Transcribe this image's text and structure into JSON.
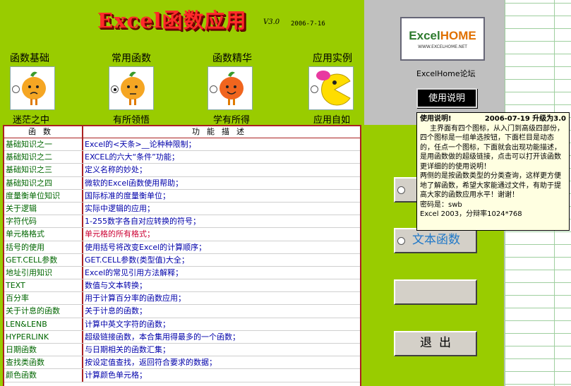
{
  "header": {
    "title": "Excel函数应用",
    "version": "V3.0",
    "date": "2006-7-16"
  },
  "categories": [
    {
      "label": "函数基础",
      "sub": "迷茫之中",
      "icon": "orange-mascot-sad-icon",
      "selected": false
    },
    {
      "label": "常用函数",
      "sub": "有所领悟",
      "icon": "orange-mascot-thinking-icon",
      "selected": true
    },
    {
      "label": "函数精华",
      "sub": "学有所得",
      "icon": "orange-mascot-happy-icon",
      "selected": false
    },
    {
      "label": "应用实例",
      "sub": "应用自如",
      "icon": "pacman-icon",
      "selected": false
    }
  ],
  "table": {
    "headers": {
      "col1": "函数",
      "col2": "功能描述"
    },
    "rows": [
      {
        "name": "基础知识之一",
        "desc": "Excel的<天条>__论种种限制；"
      },
      {
        "name": "基础知识之二",
        "desc": "EXCEL的六大“条件”功能；"
      },
      {
        "name": "基础知识之三",
        "desc": "定义名称的妙处；"
      },
      {
        "name": "基础知识之四",
        "desc": "微软的Excel函数使用帮助；"
      },
      {
        "name": "度量衡单位知识",
        "desc": "国际标准的度量衡单位；"
      },
      {
        "name": "关于逻辑",
        "desc": "实际中逻辑的应用；"
      },
      {
        "name": "字符代码",
        "desc": "1-255数字各自对应转换的符号；"
      },
      {
        "name": "单元格格式",
        "desc": "单元格的所有格式；",
        "red": true
      },
      {
        "name": "括号的使用",
        "desc": "使用括号将改变Excel的计算顺序；"
      },
      {
        "name": "GET.CELL参数",
        "desc": "GET.CELL参数(类型值)大全；"
      },
      {
        "name": "地址引用知识",
        "desc": "Excel的常见引用方法解释；"
      },
      {
        "name": "TEXT",
        "desc": "数值与文本转换；"
      },
      {
        "name": "百分率",
        "desc": "用于计算百分率的函数应用；"
      },
      {
        "name": "关于计息的函数",
        "desc": "关于计息的函数；"
      },
      {
        "name": "LEN&LENB",
        "desc": "计算中英文字符的函数；"
      },
      {
        "name": "HYPERLINK",
        "desc": "超级链接函数，本合集用得最多的一个函数；"
      },
      {
        "name": "日期函数",
        "desc": "与日期相关的函数汇集；"
      },
      {
        "name": "查找类函数",
        "desc": "按设定值查找，返回符合要求的数据；"
      },
      {
        "name": "颜色函数",
        "desc": "计算颜色单元格；"
      }
    ]
  },
  "right_panel": {
    "logo_text_1": "Excel",
    "logo_text_2": "HOME",
    "logo_url": "WWW.EXCELHOME.NET",
    "forum_label": "ExcelHome论坛",
    "help_button": "使用说明",
    "text_func_button": "文本函数",
    "empty_button": "",
    "exit_button": "退出"
  },
  "tooltip": {
    "head_left": "使用说明!",
    "head_right": "2006-07-19 升级为3.0",
    "para1": "主界面有四个图标，从入门到高级四部份，四个图标是一组单选按钮，下面栏目是动态的，任点一个图标，下面就会出现功能描述，是用函数做的超级链接，点击可以打开该函数更详细的的使用说明！",
    "para2": "两侧的是按函数类型的分类查询，这样更方便地了解函数，希望大家能通过文件，有助于提高大家的函数应用水平！谢谢！",
    "password": "密码是：swb",
    "footer": "Excel 2003，分辩率1024*768"
  },
  "colors": {
    "sheet_green": "#99cc00",
    "tooltip_bg": "#ffffe1",
    "table_border": "#aa2222"
  }
}
